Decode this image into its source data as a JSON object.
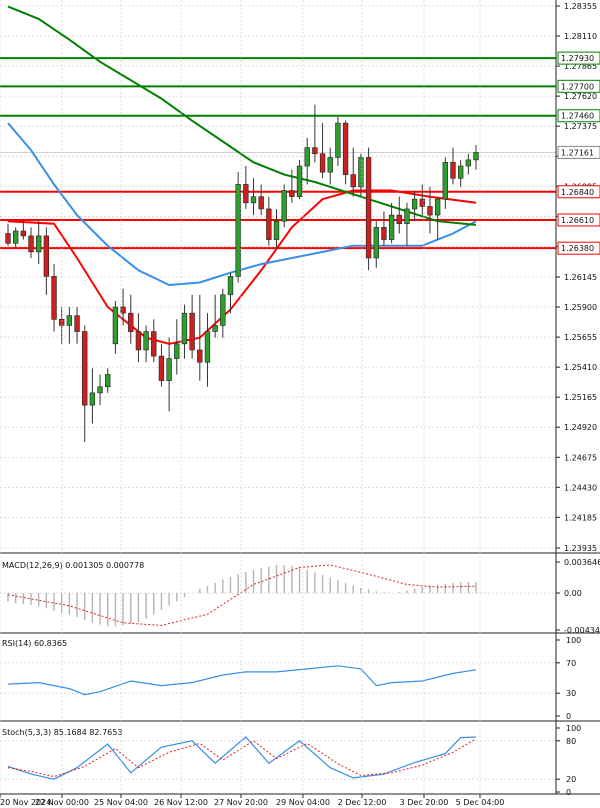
{
  "chart_data": {
    "type": "candlestick",
    "instrument_timeframe_note": "",
    "price_axis": {
      "ticks": [
        "1.28355",
        "1.28110",
        "1.27865",
        "1.27620",
        "1.27375",
        "1.27130",
        "1.26885",
        "1.26640",
        "1.26395",
        "1.26145",
        "1.25900",
        "1.25655",
        "1.25410",
        "1.25165",
        "1.24920",
        "1.24675",
        "1.24430",
        "1.24185",
        "1.23935"
      ],
      "range": [
        1.23935,
        1.28355
      ]
    },
    "levels": [
      {
        "value": 1.2793,
        "label": "1.27930",
        "color": "#008000"
      },
      {
        "value": 1.277,
        "label": "1.27700",
        "color": "#008000"
      },
      {
        "value": 1.2746,
        "label": "1.27460",
        "color": "#008000"
      },
      {
        "value": 1.2684,
        "label": "1.26840",
        "color": "#ff0000"
      },
      {
        "value": 1.2661,
        "label": "1.26610",
        "color": "#ff0000"
      },
      {
        "value": 1.2638,
        "label": "1.26380",
        "color": "#ff0000"
      }
    ],
    "last_price": {
      "value": 1.27161,
      "label": "1.27161"
    },
    "x_axis_labels": [
      "20 Nov 2024",
      "22 Nov 00:00",
      "25 Nov 04:00",
      "26 Nov 12:00",
      "27 Nov 20:00",
      "29 Nov 04:00",
      "2 Dec 12:00",
      "3 Dec 20:00",
      "5 Dec 04:00"
    ],
    "candles": [
      [
        1.265,
        1.2658,
        1.264,
        1.2642
      ],
      [
        1.2642,
        1.2655,
        1.2638,
        1.2652
      ],
      [
        1.2652,
        1.266,
        1.2645,
        1.2648
      ],
      [
        1.2648,
        1.2655,
        1.263,
        1.2635
      ],
      [
        1.2635,
        1.266,
        1.2625,
        1.2648
      ],
      [
        1.2648,
        1.2655,
        1.26,
        1.2615
      ],
      [
        1.2615,
        1.2625,
        1.257,
        1.258
      ],
      [
        1.258,
        1.259,
        1.256,
        1.2575
      ],
      [
        1.2575,
        1.259,
        1.256,
        1.2583
      ],
      [
        1.2583,
        1.259,
        1.256,
        1.257
      ],
      [
        1.257,
        1.2575,
        1.248,
        1.251
      ],
      [
        1.251,
        1.254,
        1.2495,
        1.252
      ],
      [
        1.252,
        1.2535,
        1.251,
        1.2525
      ],
      [
        1.2525,
        1.254,
        1.252,
        1.2535
      ],
      [
        1.256,
        1.2595,
        1.2552,
        1.259
      ],
      [
        1.259,
        1.2605,
        1.2575,
        1.2585
      ],
      [
        1.2585,
        1.26,
        1.256,
        1.257
      ],
      [
        1.257,
        1.2585,
        1.2545,
        1.2555
      ],
      [
        1.2555,
        1.2575,
        1.2545,
        1.257
      ],
      [
        1.257,
        1.258,
        1.2545,
        1.255
      ],
      [
        1.255,
        1.256,
        1.2525,
        1.253
      ],
      [
        1.253,
        1.2565,
        1.2505,
        1.2548
      ],
      [
        1.2548,
        1.258,
        1.2535,
        1.256
      ],
      [
        1.256,
        1.2592,
        1.2548,
        1.2585
      ],
      [
        1.2585,
        1.26,
        1.2548,
        1.2555
      ],
      [
        1.2555,
        1.26,
        1.253,
        1.2545
      ],
      [
        1.2545,
        1.2585,
        1.2525,
        1.257
      ],
      [
        1.257,
        1.26,
        1.2565,
        1.2575
      ],
      [
        1.2575,
        1.2605,
        1.2565,
        1.26
      ],
      [
        1.26,
        1.2618,
        1.2585,
        1.2615
      ],
      [
        1.2615,
        1.27,
        1.261,
        1.269
      ],
      [
        1.269,
        1.2705,
        1.267,
        1.2675
      ],
      [
        1.2675,
        1.2695,
        1.2665,
        1.268
      ],
      [
        1.268,
        1.269,
        1.2665,
        1.267
      ],
      [
        1.267,
        1.268,
        1.264,
        1.2645
      ],
      [
        1.2645,
        1.267,
        1.2638,
        1.266
      ],
      [
        1.266,
        1.269,
        1.2655,
        1.2685
      ],
      [
        1.2685,
        1.2702,
        1.2675,
        1.268
      ],
      [
        1.268,
        1.271,
        1.2678,
        1.2705
      ],
      [
        1.2705,
        1.2728,
        1.269,
        1.272
      ],
      [
        1.272,
        1.2755,
        1.2708,
        1.2715
      ],
      [
        1.2715,
        1.274,
        1.2695,
        1.27
      ],
      [
        1.27,
        1.272,
        1.269,
        1.2712
      ],
      [
        1.2712,
        1.2745,
        1.2705,
        1.274
      ],
      [
        1.274,
        1.2742,
        1.269,
        1.2698
      ],
      [
        1.2698,
        1.272,
        1.268,
        1.2688
      ],
      [
        1.2688,
        1.2715,
        1.268,
        1.2712
      ],
      [
        1.2712,
        1.272,
        1.262,
        1.263
      ],
      [
        1.263,
        1.266,
        1.2622,
        1.2655
      ],
      [
        1.2655,
        1.2668,
        1.264,
        1.2645
      ],
      [
        1.2645,
        1.2675,
        1.2642,
        1.2665
      ],
      [
        1.2665,
        1.268,
        1.265,
        1.2658
      ],
      [
        1.2658,
        1.2675,
        1.264,
        1.267
      ],
      [
        1.267,
        1.2685,
        1.266,
        1.2678
      ],
      [
        1.2678,
        1.269,
        1.2665,
        1.2672
      ],
      [
        1.2672,
        1.2688,
        1.265,
        1.2665
      ],
      [
        1.2665,
        1.268,
        1.2645,
        1.2678
      ],
      [
        1.2678,
        1.2712,
        1.267,
        1.2708
      ],
      [
        1.2708,
        1.272,
        1.269,
        1.2695
      ],
      [
        1.2695,
        1.271,
        1.2688,
        1.2705
      ],
      [
        1.2705,
        1.2715,
        1.2698,
        1.271
      ],
      [
        1.271,
        1.2722,
        1.2702,
        1.2716
      ]
    ],
    "moving_averages": [
      {
        "color": "#ff0000",
        "points": [
          [
            0,
            1.266
          ],
          [
            6,
            1.2658
          ],
          [
            9,
            1.263
          ],
          [
            13,
            1.259
          ],
          [
            18,
            1.2565
          ],
          [
            21,
            1.256
          ],
          [
            25,
            1.2565
          ],
          [
            29,
            1.2588
          ],
          [
            33,
            1.262
          ],
          [
            37,
            1.2655
          ],
          [
            41,
            1.2678
          ],
          [
            45,
            1.2685
          ],
          [
            50,
            1.2685
          ],
          [
            55,
            1.268
          ],
          [
            61,
            1.2675
          ]
        ]
      },
      {
        "color": "#3a8ee6",
        "points": [
          [
            0,
            1.274
          ],
          [
            3,
            1.2718
          ],
          [
            6,
            1.269
          ],
          [
            9,
            1.2665
          ],
          [
            13,
            1.264
          ],
          [
            17,
            1.262
          ],
          [
            21,
            1.2608
          ],
          [
            25,
            1.261
          ],
          [
            29,
            1.2618
          ],
          [
            33,
            1.2625
          ],
          [
            37,
            1.263
          ],
          [
            41,
            1.2635
          ],
          [
            45,
            1.264
          ],
          [
            50,
            1.264
          ],
          [
            54,
            1.264
          ],
          [
            58,
            1.265
          ],
          [
            61,
            1.266
          ]
        ]
      },
      {
        "color": "#008000",
        "points": [
          [
            0,
            1.2835
          ],
          [
            4,
            1.2825
          ],
          [
            8,
            1.2808
          ],
          [
            12,
            1.279
          ],
          [
            16,
            1.2775
          ],
          [
            20,
            1.276
          ],
          [
            24,
            1.2742
          ],
          [
            28,
            1.2725
          ],
          [
            32,
            1.2708
          ],
          [
            36,
            1.2698
          ],
          [
            40,
            1.2692
          ],
          [
            44,
            1.2684
          ],
          [
            48,
            1.2676
          ],
          [
            52,
            1.2668
          ],
          [
            56,
            1.266
          ],
          [
            61,
            1.2657
          ]
        ]
      }
    ],
    "indicators": [
      {
        "name": "MACD",
        "label": "MACD(12,26,9) 0.001305 0.000778",
        "ticks": [
          "0.003646",
          "0.00",
          "-0.004344"
        ],
        "range": [
          -0.004344,
          0.003646
        ],
        "histogram": [
          -0.001,
          -0.0012,
          -0.0013,
          -0.0014,
          -0.0016,
          -0.0018,
          -0.0021,
          -0.0024,
          -0.0026,
          -0.0028,
          -0.0032,
          -0.0035,
          -0.0037,
          -0.0039,
          -0.0039,
          -0.0038,
          -0.0036,
          -0.0034,
          -0.003,
          -0.0025,
          -0.002,
          -0.0015,
          -0.001,
          -0.0005,
          0.0,
          0.0005,
          0.0008,
          0.0012,
          0.0016,
          0.0019,
          0.0022,
          0.0025,
          0.0027,
          0.0029,
          0.0031,
          0.0033,
          0.0033,
          0.0032,
          0.003,
          0.0027,
          0.0024,
          0.0021,
          0.0018,
          0.0015,
          0.0012,
          0.0009,
          0.0006,
          0.0004,
          0.0002,
          0.0001,
          0.0,
          0.0001,
          0.0003,
          0.0005,
          0.0007,
          0.0009,
          0.001,
          0.0011,
          0.0012,
          0.0013,
          0.0013,
          0.0013
        ],
        "signal": [
          [
            0,
            -0.0002
          ],
          [
            8,
            -0.0015
          ],
          [
            15,
            -0.0035
          ],
          [
            20,
            -0.0038
          ],
          [
            26,
            -0.0025
          ],
          [
            32,
            0.001
          ],
          [
            38,
            0.003
          ],
          [
            42,
            0.0033
          ],
          [
            47,
            0.0022
          ],
          [
            52,
            0.001
          ],
          [
            56,
            0.0007
          ],
          [
            61,
            0.0008
          ]
        ]
      },
      {
        "name": "RSI",
        "label": "RSI(14) 60.8365",
        "ticks": [
          "100",
          "70",
          "30",
          "0"
        ],
        "range": [
          0,
          100
        ],
        "line": [
          [
            0,
            42
          ],
          [
            4,
            44
          ],
          [
            8,
            36
          ],
          [
            10,
            28
          ],
          [
            12,
            32
          ],
          [
            16,
            46
          ],
          [
            20,
            40
          ],
          [
            24,
            44
          ],
          [
            28,
            54
          ],
          [
            31,
            58
          ],
          [
            35,
            58
          ],
          [
            39,
            62
          ],
          [
            43,
            66
          ],
          [
            46,
            62
          ],
          [
            48,
            40
          ],
          [
            50,
            44
          ],
          [
            54,
            46
          ],
          [
            58,
            56
          ],
          [
            61,
            60.8
          ]
        ]
      },
      {
        "name": "Stoch",
        "label": "Stoch(5,3,3) 85.1684 82.7653",
        "ticks": [
          "100",
          "80",
          "20",
          "0"
        ],
        "range": [
          0,
          100
        ],
        "k": [
          [
            0,
            40
          ],
          [
            3,
            28
          ],
          [
            6,
            20
          ],
          [
            9,
            38
          ],
          [
            13,
            75
          ],
          [
            16,
            30
          ],
          [
            20,
            70
          ],
          [
            24,
            80
          ],
          [
            27,
            45
          ],
          [
            31,
            86
          ],
          [
            34,
            45
          ],
          [
            38,
            80
          ],
          [
            42,
            38
          ],
          [
            45,
            22
          ],
          [
            49,
            28
          ],
          [
            53,
            46
          ],
          [
            57,
            60
          ],
          [
            59,
            85
          ],
          [
            61,
            86
          ]
        ],
        "d": [
          [
            0,
            38
          ],
          [
            3,
            32
          ],
          [
            6,
            24
          ],
          [
            10,
            40
          ],
          [
            14,
            68
          ],
          [
            17,
            38
          ],
          [
            21,
            62
          ],
          [
            25,
            76
          ],
          [
            28,
            50
          ],
          [
            32,
            80
          ],
          [
            35,
            52
          ],
          [
            39,
            76
          ],
          [
            43,
            44
          ],
          [
            46,
            26
          ],
          [
            50,
            30
          ],
          [
            54,
            42
          ],
          [
            58,
            62
          ],
          [
            61,
            83
          ]
        ]
      }
    ]
  }
}
